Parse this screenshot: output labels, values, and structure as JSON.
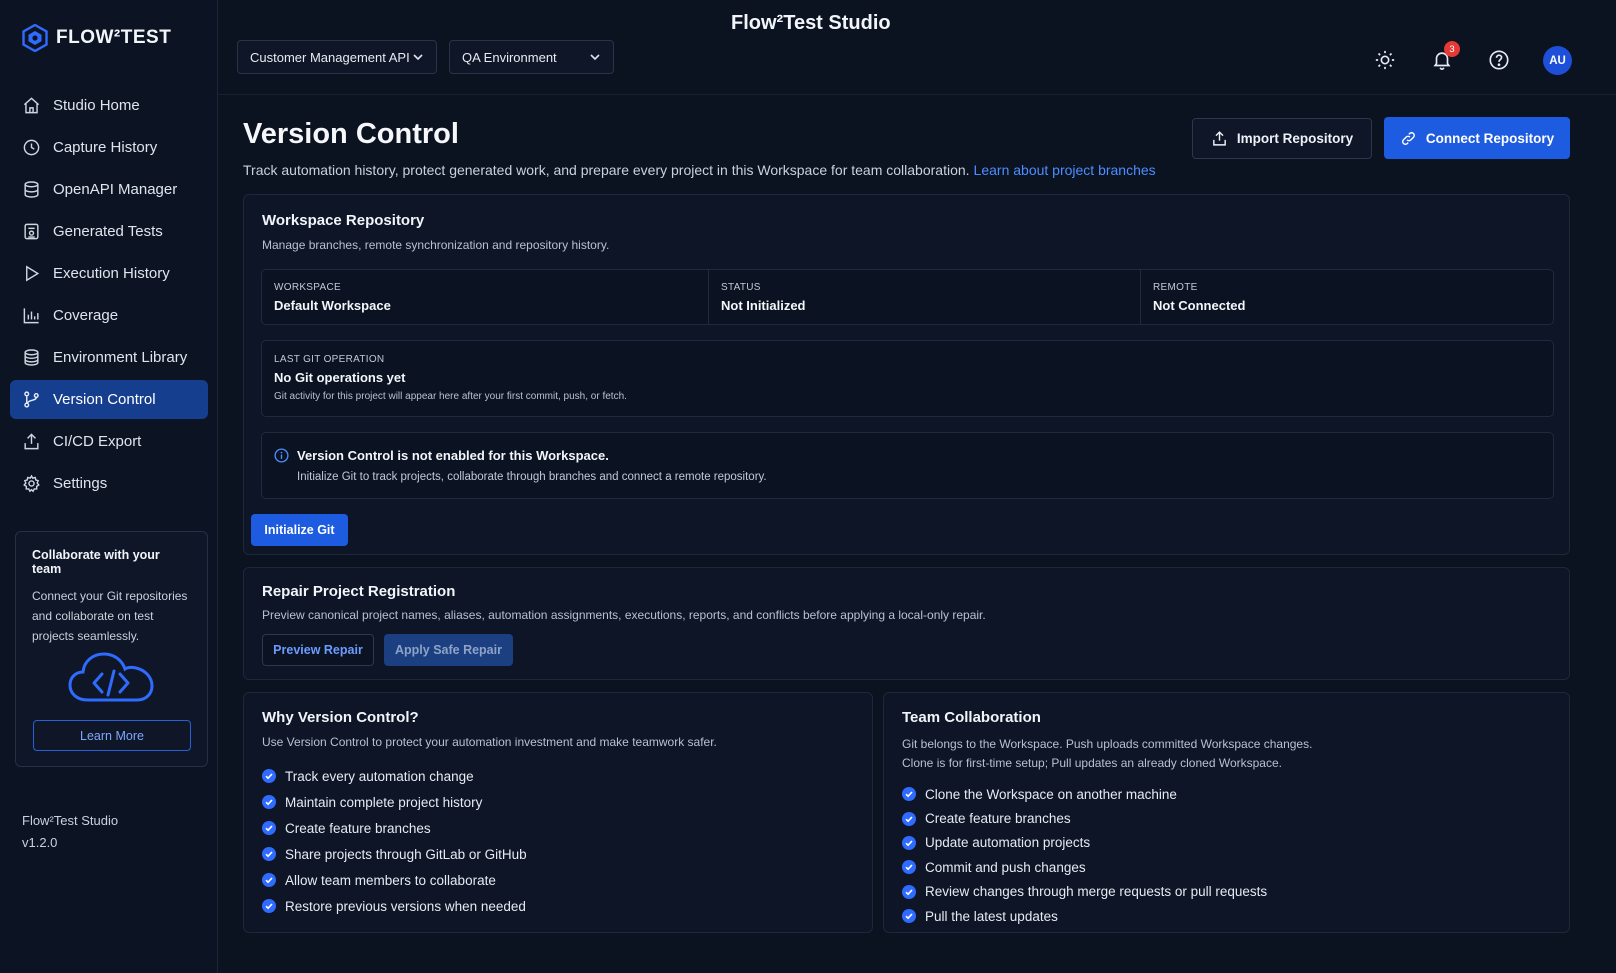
{
  "brand": {
    "logo_text": "FLOW²TEST"
  },
  "sidebar": {
    "items": [
      {
        "label": "Studio Home",
        "icon": "home-icon"
      },
      {
        "label": "Capture History",
        "icon": "clock-icon"
      },
      {
        "label": "OpenAPI Manager",
        "icon": "database-icon"
      },
      {
        "label": "Generated Tests",
        "icon": "document-test-icon"
      },
      {
        "label": "Execution History",
        "icon": "play-icon"
      },
      {
        "label": "Coverage",
        "icon": "bar-chart-icon"
      },
      {
        "label": "Environment Library",
        "icon": "stack-icon"
      },
      {
        "label": "Version Control",
        "icon": "git-branch-icon",
        "active": true
      },
      {
        "label": "CI/CD Export",
        "icon": "upload-icon"
      },
      {
        "label": "Settings",
        "icon": "gear-icon"
      }
    ],
    "collab_card": {
      "title": "Collaborate with your team",
      "description": "Connect your Git repositories and collaborate on test projects seamlessly.",
      "button_label": "Learn More"
    },
    "app_name": "Flow²Test Studio",
    "version": "v1.2.0"
  },
  "header": {
    "app_title": "Flow²Test Studio",
    "project_select": "Customer Management API",
    "environment_select": "QA Environment",
    "notification_count": "3",
    "avatar_initials": "AU"
  },
  "page": {
    "title": "Version Control",
    "description": "Track automation history, protect generated work, and prepare every project in this Workspace for team collaboration.",
    "description_link": "Learn about project branches",
    "import_button": "Import Repository",
    "connect_button": "Connect Repository"
  },
  "workspace_repo": {
    "title": "Workspace Repository",
    "subtitle": "Manage branches, remote synchronization and repository history.",
    "stats": [
      {
        "label": "WORKSPACE",
        "value": "Default Workspace"
      },
      {
        "label": "STATUS",
        "value": "Not Initialized"
      },
      {
        "label": "REMOTE",
        "value": "Not Connected"
      }
    ],
    "last_git": {
      "label": "LAST GIT OPERATION",
      "value": "No Git operations yet",
      "description": "Git activity for this project will appear here after your first commit, push, or fetch."
    },
    "info": {
      "title": "Version Control is not enabled for this Workspace.",
      "description": "Initialize Git to track projects, collaborate through branches and connect a remote repository."
    },
    "init_button": "Initialize Git"
  },
  "repair": {
    "title": "Repair Project Registration",
    "subtitle": "Preview canonical project names, aliases, automation assignments, executions, reports, and conflicts before applying a local-only repair.",
    "preview_button": "Preview Repair",
    "apply_button": "Apply Safe Repair"
  },
  "why": {
    "title": "Why Version Control?",
    "subtitle": "Use Version Control to protect your automation investment and make teamwork safer.",
    "items": [
      "Track every automation change",
      "Maintain complete project history",
      "Create feature branches",
      "Share projects through GitLab or GitHub",
      "Allow team members to collaborate",
      "Restore previous versions when needed"
    ]
  },
  "team": {
    "title": "Team Collaboration",
    "subtitle_line1": "Git belongs to the Workspace. Push uploads committed Workspace changes.",
    "subtitle_line2": "Clone is for first-time setup; Pull updates an already cloned Workspace.",
    "items": [
      "Clone the Workspace on another machine",
      "Create feature branches",
      "Update automation projects",
      "Commit and push changes",
      "Review changes through merge requests or pull requests",
      "Pull the latest updates"
    ]
  },
  "colors": {
    "background": "#0b1220",
    "accent": "#1d5be0",
    "active_nav": "#163e8f",
    "link": "#4d8dff",
    "badge": "#e53935"
  }
}
